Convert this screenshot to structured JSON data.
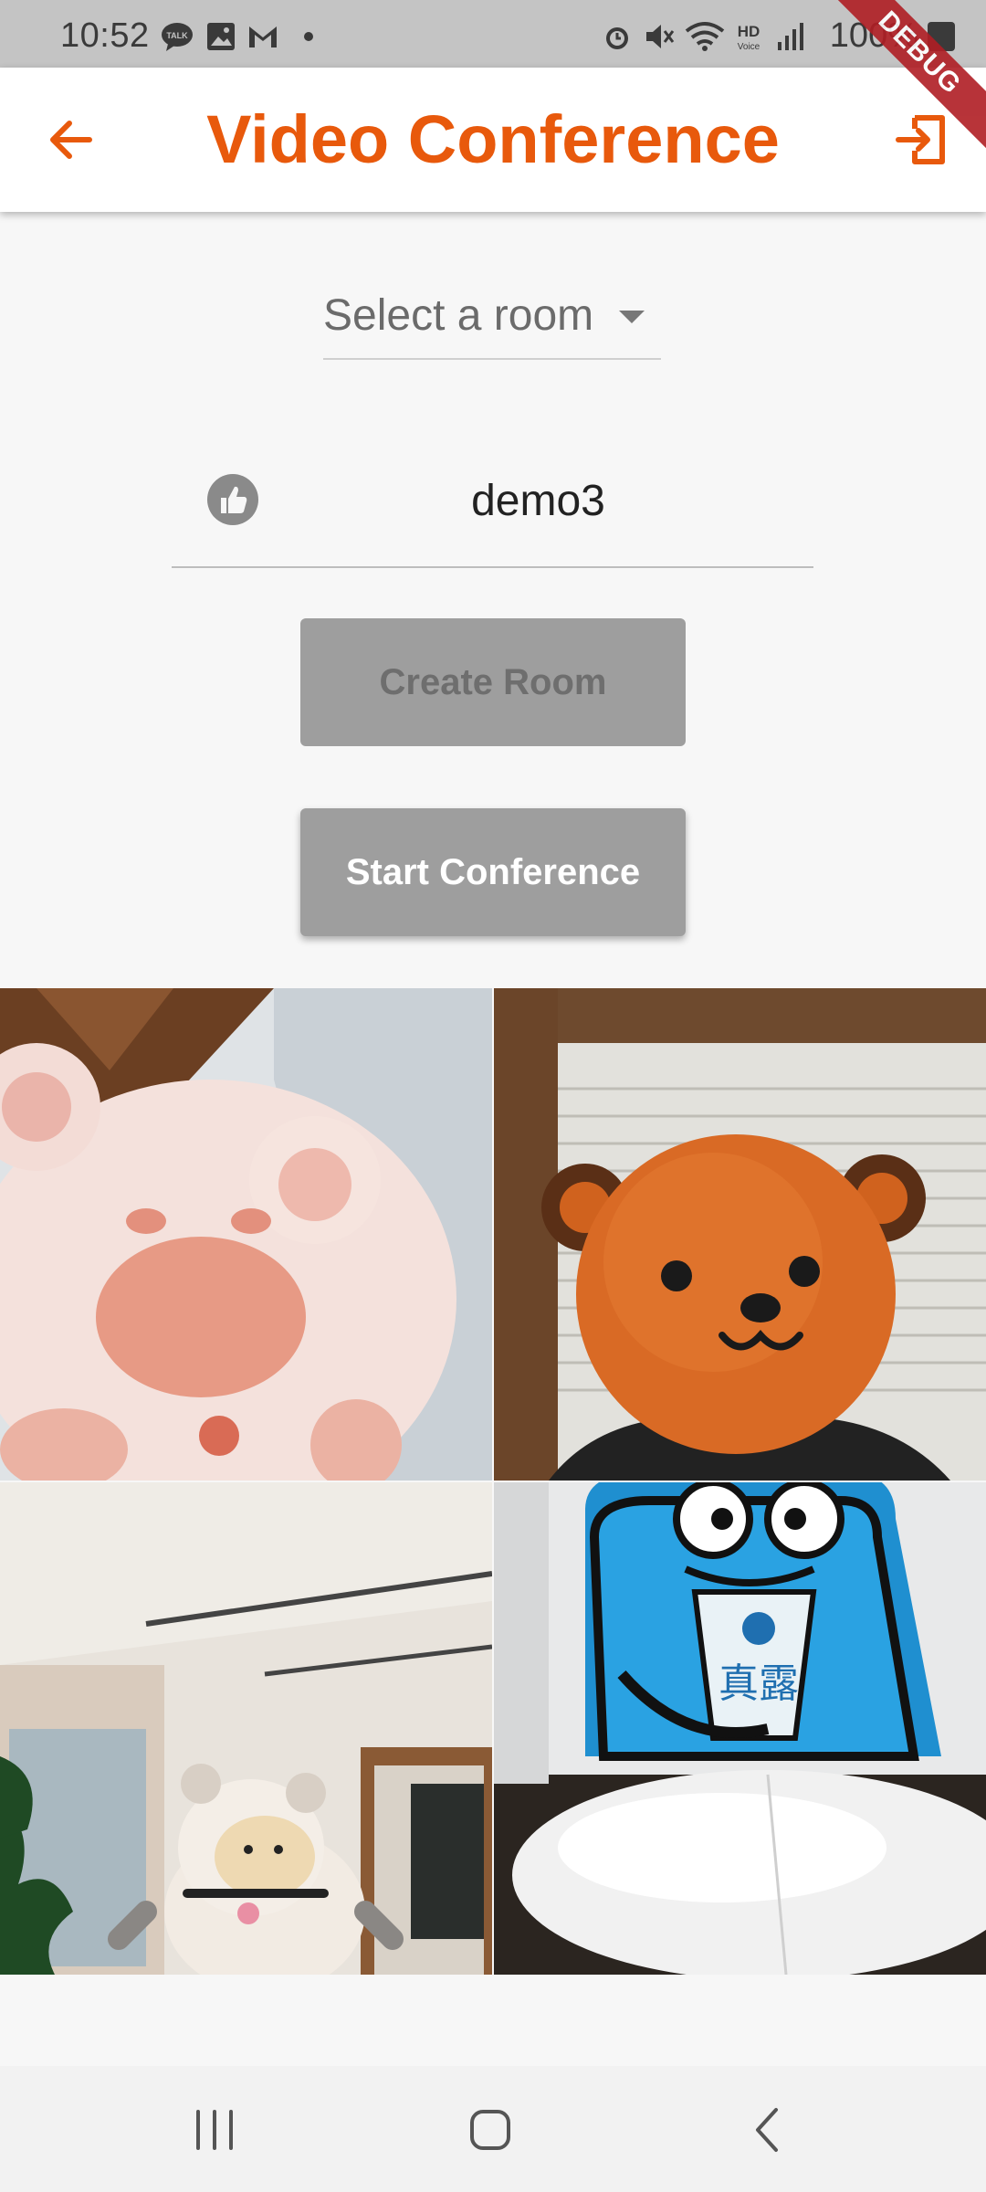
{
  "status_bar": {
    "time": "10:52",
    "battery": "100%",
    "left_icons": [
      "talk-icon",
      "image-icon",
      "gmail-icon",
      "dot-icon"
    ],
    "right_icons": [
      "alarm-icon",
      "mute-icon",
      "wifi-icon",
      "hd-voice-icon",
      "signal-icon",
      "battery-icon"
    ]
  },
  "debug_banner": "DEBUG",
  "app_bar": {
    "title": "Video Conference",
    "back_icon": "arrow-left-icon",
    "exit_icon": "exit-icon"
  },
  "room_select": {
    "label": "Select a room"
  },
  "name_field": {
    "value": "demo3",
    "icon": "thumbs-up-icon"
  },
  "buttons": {
    "create_room": "Create Room",
    "start_conference": "Start Conference"
  },
  "video_tiles": [
    {
      "subject": "pink plush bear"
    },
    {
      "subject": "orange bear mask"
    },
    {
      "subject": "rilakkuma plush in room"
    },
    {
      "subject": "blue frog box"
    }
  ],
  "accent_color": "#e8590c",
  "nav_bar": {
    "icons": [
      "recents-icon",
      "home-icon",
      "back-icon"
    ]
  }
}
